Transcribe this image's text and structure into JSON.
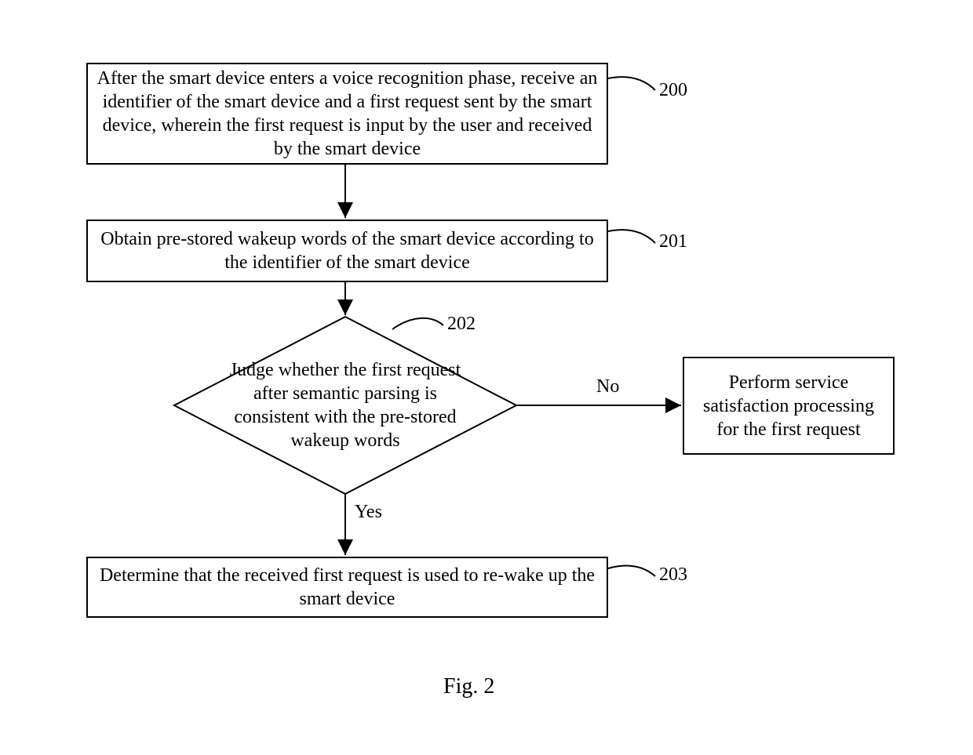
{
  "nodes": {
    "step200": {
      "text": "After the smart device enters a voice recognition phase, receive an identifier of the smart device and a first request sent by the smart device, wherein the first request is input by the user and received by the smart device",
      "ref": "200"
    },
    "step201": {
      "text": "Obtain pre-stored wakeup words of the smart device according to the identifier of the smart device",
      "ref": "201"
    },
    "decision202": {
      "text": "Judge whether the first request after semantic parsing is consistent with the pre-stored wakeup words",
      "ref": "202"
    },
    "step203": {
      "text": "Determine that the received first request is used to re-wake up the smart device",
      "ref": "203"
    },
    "service": {
      "text": "Perform service satisfaction processing for the first request"
    }
  },
  "edges": {
    "yes": "Yes",
    "no": "No"
  },
  "caption": "Fig. 2"
}
